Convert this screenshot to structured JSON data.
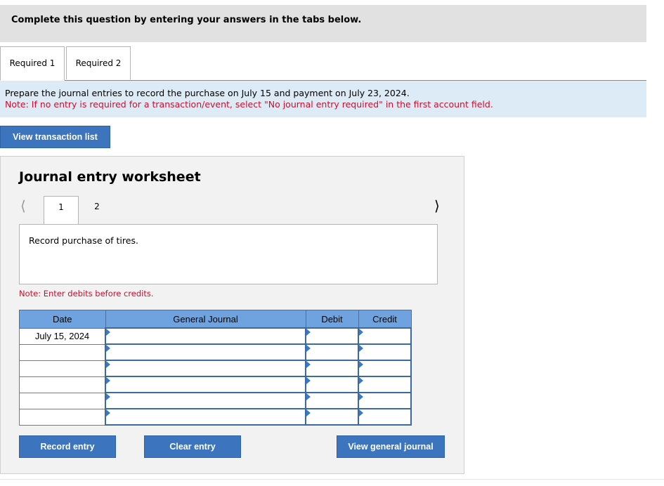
{
  "header": {
    "instruction": "Complete this question by entering your answers in the tabs below."
  },
  "tabs": [
    {
      "label": "Required 1",
      "active": true
    },
    {
      "label": "Required 2",
      "active": false
    }
  ],
  "prompt": {
    "line1": "Prepare the journal entries to record the purchase on July 15 and payment on July 23, 2024.",
    "line2": "Note: If no entry is required for a transaction/event, select \"No journal entry required\" in the first account field."
  },
  "buttons": {
    "view_transactions": "View transaction list",
    "record": "Record entry",
    "clear": "Clear entry",
    "view_general": "View general journal"
  },
  "worksheet": {
    "title": "Journal entry worksheet",
    "prev_icon": "chevron-left",
    "next_icon": "chevron-right",
    "tabs": [
      "1",
      "2"
    ],
    "description": "Record purchase of tires.",
    "note": "Note: Enter debits before credits.",
    "columns": {
      "date": "Date",
      "journal": "General Journal",
      "debit": "Debit",
      "credit": "Credit"
    },
    "rows": [
      {
        "date": "July 15, 2024",
        "account": "",
        "debit": "",
        "credit": ""
      },
      {
        "date": "",
        "account": "",
        "debit": "",
        "credit": ""
      },
      {
        "date": "",
        "account": "",
        "debit": "",
        "credit": ""
      },
      {
        "date": "",
        "account": "",
        "debit": "",
        "credit": ""
      },
      {
        "date": "",
        "account": "",
        "debit": "",
        "credit": ""
      },
      {
        "date": "",
        "account": "",
        "debit": "",
        "credit": ""
      }
    ]
  },
  "colors": {
    "button": "#3c75be",
    "header": "#6fa3df",
    "note": "#c8102e",
    "info_bg": "#dcebf6"
  }
}
